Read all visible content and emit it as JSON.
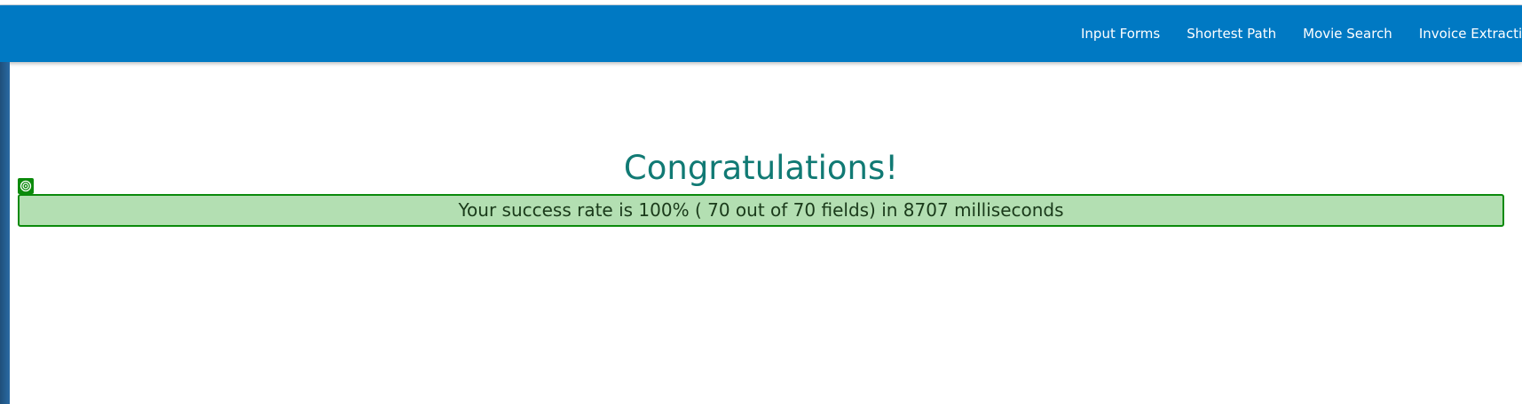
{
  "navbar": {
    "links": [
      "Input Forms",
      "Shortest Path",
      "Movie Search",
      "Invoice Extraction"
    ]
  },
  "main": {
    "title": "Congratulations!",
    "result_text": "Your success rate is 100% ( 70 out of 70 fields) in 8707 milliseconds"
  },
  "icons": {
    "result_marker": "target-icon"
  },
  "colors": {
    "navbar": "#0079c3",
    "title": "#117a74",
    "success_bg": "#b3dfb2",
    "success_border": "#0b8a0b"
  }
}
